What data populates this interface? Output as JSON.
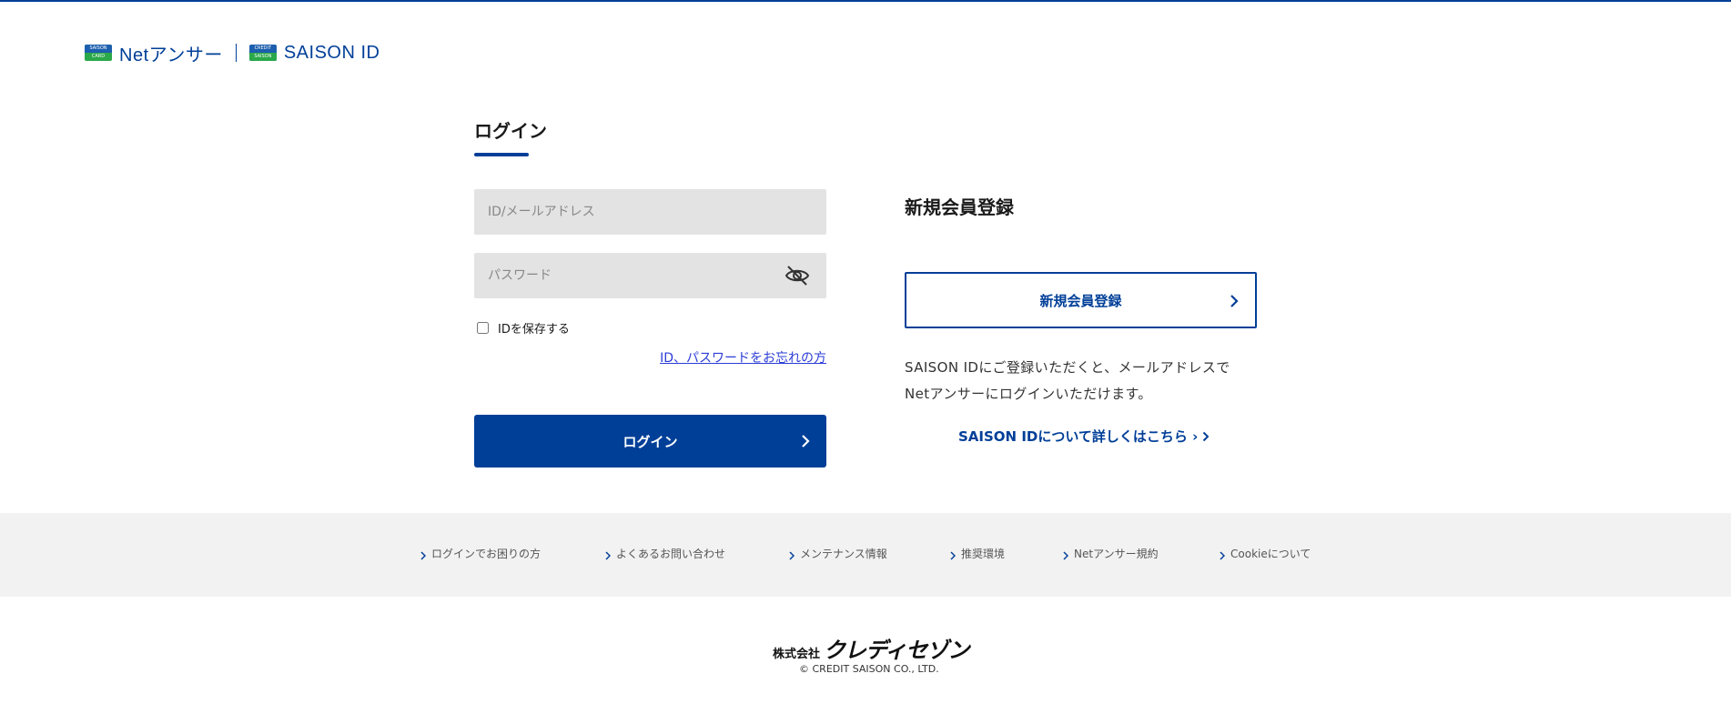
{
  "header": {
    "netanswer_text": "Netアンサー",
    "saison_id_text": "SAISON ID",
    "card_icon_1_text": "SAISON CARD",
    "card_icon_2_text": "CREDIT SAISON"
  },
  "login": {
    "title": "ログイン",
    "id_placeholder": "ID/メールアドレス",
    "password_placeholder": "パスワード",
    "remember_label": "IDを保存する",
    "forgot_link": "ID、パスワードをお忘れの方",
    "submit_label": "ログイン"
  },
  "register": {
    "heading": "新規会員登録",
    "button_label": "新規会員登録",
    "description_line1": "SAISON IDにご登録いただくと、メールアドレスで",
    "description_line2": "Netアンサーにログインいただけます。",
    "saison_id_link": "SAISON IDについて詳しくはこちら ›"
  },
  "footer": {
    "links": [
      "ログインでお困りの方",
      "よくあるお問い合わせ",
      "メンテナンス情報",
      "推奨環境",
      "Netアンサー規約",
      "Cookieについて"
    ],
    "company_prefix": "株式会社",
    "company_name": "クレディセゾン",
    "copyright": "© CREDIT SAISON CO., LTD."
  },
  "colors": {
    "brand_blue": "#003f98",
    "field_bg": "#e3e3e3",
    "footer_bg": "#f2f2f2",
    "link_blue": "#2b3cd6"
  },
  "icons": [
    "eye-slash-icon",
    "chevron-right-icon"
  ]
}
